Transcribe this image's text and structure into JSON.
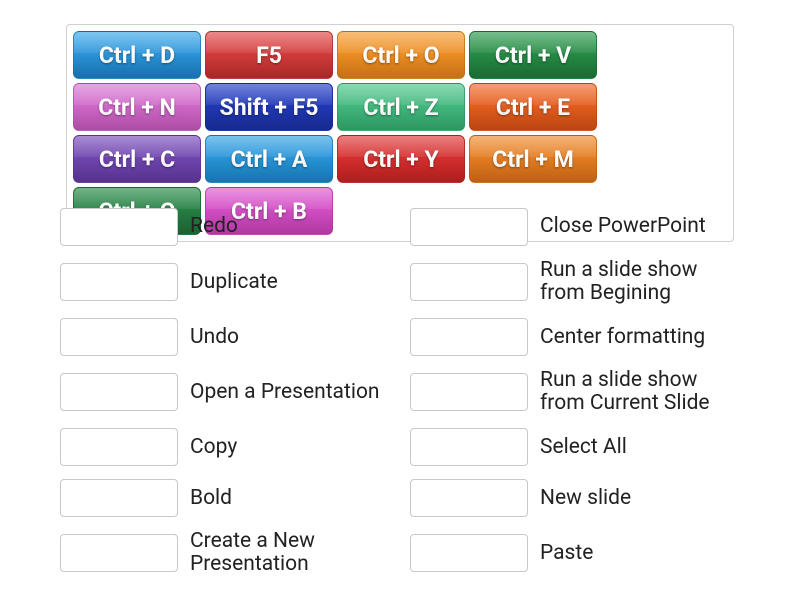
{
  "tiles": [
    {
      "label": "Ctrl + D",
      "color": "c-blue1"
    },
    {
      "label": "F5",
      "color": "c-red"
    },
    {
      "label": "Ctrl + O",
      "color": "c-orange"
    },
    {
      "label": "Ctrl + V",
      "color": "c-green"
    },
    {
      "label": "Ctrl + N",
      "color": "c-pink"
    },
    {
      "label": "Shift + F5",
      "color": "c-dblue"
    },
    {
      "label": "Ctrl + Z",
      "color": "c-teal"
    },
    {
      "label": "Ctrl + E",
      "color": "c-dorange"
    },
    {
      "label": "Ctrl + C",
      "color": "c-purple"
    },
    {
      "label": "Ctrl + A",
      "color": "c-blue2"
    },
    {
      "label": "Ctrl + Y",
      "color": "c-red2"
    },
    {
      "label": "Ctrl + M",
      "color": "c-orange2"
    },
    {
      "label": "Ctrl + Q",
      "color": "c-green2"
    },
    {
      "label": "Ctrl + B",
      "color": "c-magenta"
    }
  ],
  "answers_left": [
    {
      "label": "Redo"
    },
    {
      "label": "Duplicate"
    },
    {
      "label": "Undo"
    },
    {
      "label": "Open a Presentation"
    },
    {
      "label": "Copy"
    },
    {
      "label": "Bold"
    },
    {
      "label": "Create a New Presentation"
    }
  ],
  "answers_right": [
    {
      "label": "Close PowerPoint"
    },
    {
      "label": "Run a slide show from Begining"
    },
    {
      "label": "Center formatting"
    },
    {
      "label": "Run a slide show from Current Slide"
    },
    {
      "label": "Select All"
    },
    {
      "label": "New slide"
    },
    {
      "label": "Paste"
    }
  ]
}
